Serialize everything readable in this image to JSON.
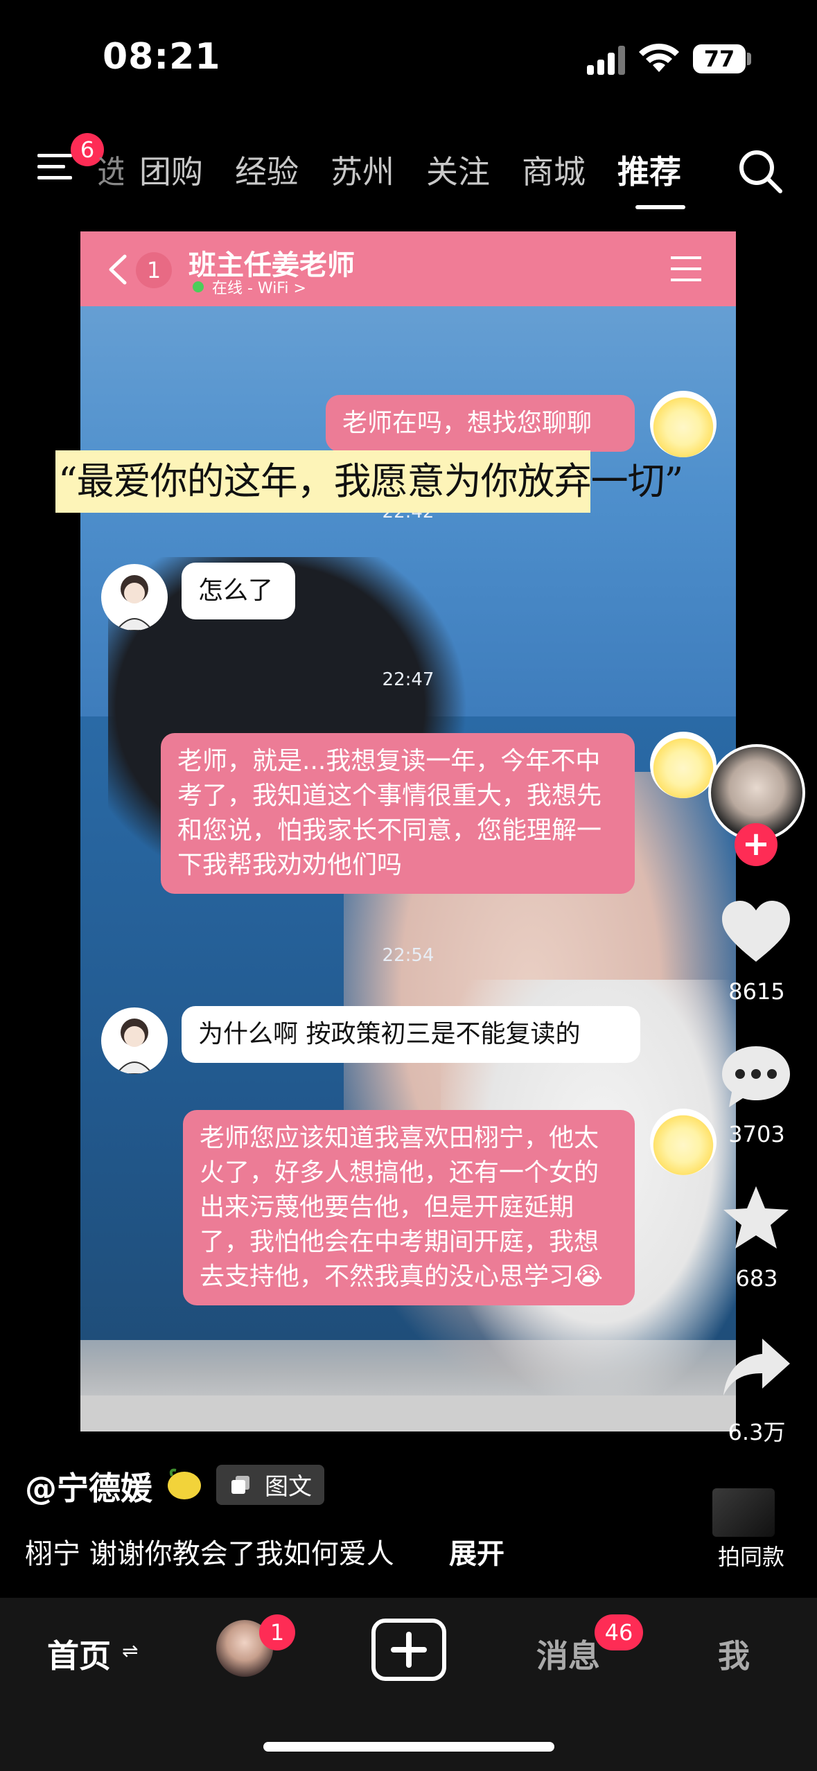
{
  "status_bar": {
    "time": "08:21",
    "battery": "77"
  },
  "top_nav": {
    "menu_badge": "6",
    "tabs": [
      "选",
      "团购",
      "经验",
      "苏州",
      "关注",
      "商城",
      "推荐"
    ],
    "active_tab": "推荐"
  },
  "chat": {
    "unread": "1",
    "contact_name": "班主任姜老师",
    "status": "在线 - WiFi >",
    "messages": [
      {
        "from": "me",
        "text": "老师在吗，想找您聊聊"
      },
      {
        "time": "22:42"
      },
      {
        "from": "them",
        "text": "怎么了"
      },
      {
        "time": "22:47"
      },
      {
        "from": "me",
        "text": "老师，就是...我想复读一年，今年不中考了，我知道这个事情很重大，我想先和您说，怕我家长不同意，您能理解一下我帮我劝劝他们吗"
      },
      {
        "time": "22:54"
      },
      {
        "from": "them",
        "text": "为什么啊 按政策初三是不能复读的"
      },
      {
        "from": "me",
        "text": "老师您应该知道我喜欢田栩宁，他太火了，好多人想搞他，还有一个女的出来污蔑他要告他，但是开庭延期了，我怕他会在中考期间开庭，我想去支持他，不然我真的没心思学习😭"
      }
    ]
  },
  "overlay_caption": "“最爱你的这年，我愿意为你放弃一切”",
  "actions": {
    "likes": "8615",
    "comments": "3703",
    "favorites": "683",
    "shares": "6.3万",
    "similar_label": "拍同款"
  },
  "post": {
    "author": "@宁德媛",
    "type_tag": "图文",
    "description": "栩宁 谢谢你教会了我如何爱人",
    "expand": "展开"
  },
  "bottom_nav": {
    "home": "首页",
    "home_switch": "⇌",
    "friend_badge": "1",
    "inbox": "消息",
    "inbox_badge": "46",
    "me": "我"
  },
  "colors": {
    "accent": "#fe2c55",
    "chat_header": "#f07c96",
    "my_bubble": "#ec7c96",
    "caption_highlight": "#fdf4b8"
  }
}
